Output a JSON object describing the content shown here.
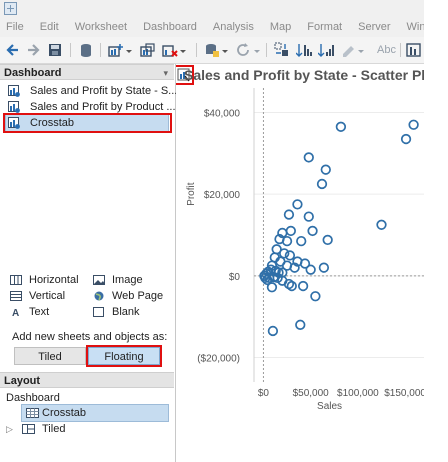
{
  "menu": [
    "File",
    "Edit",
    "Worksheet",
    "Dashboard",
    "Analysis",
    "Map",
    "Format",
    "Server",
    "Window"
  ],
  "toolbar": {
    "abc_label": "Abc"
  },
  "dashboard_pane": {
    "header": "Dashboard",
    "pin_icon": "▾",
    "sheets": [
      {
        "label": "Sales and Profit by State - S...",
        "icon": "sheet-used-icon"
      },
      {
        "label": "Sales and Profit by Product ...",
        "icon": "sheet-used-icon"
      },
      {
        "label": "Crosstab",
        "icon": "sheet-used-icon",
        "selected": true
      }
    ],
    "objects": [
      {
        "label": "Horizontal",
        "icon": "horizontal-container-icon"
      },
      {
        "label": "Image",
        "icon": "image-icon"
      },
      {
        "label": "Vertical",
        "icon": "vertical-container-icon"
      },
      {
        "label": "Web Page",
        "icon": "globe-icon"
      },
      {
        "label": "Text",
        "icon": "text-icon"
      },
      {
        "label": "Blank",
        "icon": "blank-icon"
      }
    ],
    "add_new_label": "Add new sheets and objects as:",
    "tiled_label": "Tiled",
    "floating_label": "Floating",
    "floating_selected": true
  },
  "layout_pane": {
    "header": "Layout",
    "root": "Dashboard",
    "items": [
      {
        "label": "Crosstab",
        "selected": true
      },
      {
        "label": "Tiled",
        "expandable": true
      }
    ]
  },
  "view": {
    "title": "Sales and Profit by State - Scatter Pl",
    "highlight_color": "#e01010",
    "point_color": "#2f6fa8"
  },
  "chart_data": {
    "type": "scatter",
    "title": "Sales and Profit by State - Scatter Pl",
    "xlabel": "Sales",
    "ylabel": "Profit",
    "xlim": [
      -10000,
      170000
    ],
    "ylim": [
      -26000,
      46000
    ],
    "x_ticks": [
      0,
      50000,
      100000,
      150000
    ],
    "x_tick_labels": [
      "$0",
      "$50,000",
      "$100,000",
      "$150,000"
    ],
    "y_ticks": [
      -20000,
      0,
      20000,
      40000
    ],
    "y_tick_labels": [
      "($20,000)",
      "$0",
      "$20,000",
      "$40,000"
    ],
    "zero_lines": true,
    "points": [
      [
        82000,
        36500
      ],
      [
        159000,
        37000
      ],
      [
        151000,
        33500
      ],
      [
        48000,
        29000
      ],
      [
        66000,
        26000
      ],
      [
        62000,
        22500
      ],
      [
        125000,
        12500
      ],
      [
        20000,
        10500
      ],
      [
        36000,
        17500
      ],
      [
        27000,
        15000
      ],
      [
        48000,
        14500
      ],
      [
        52000,
        11000
      ],
      [
        29000,
        11000
      ],
      [
        17000,
        9000
      ],
      [
        25000,
        8500
      ],
      [
        40000,
        8500
      ],
      [
        68000,
        8800
      ],
      [
        14000,
        6500
      ],
      [
        22000,
        5500
      ],
      [
        28000,
        5000
      ],
      [
        12000,
        4500
      ],
      [
        18000,
        3500
      ],
      [
        36000,
        3500
      ],
      [
        44000,
        3000
      ],
      [
        9000,
        2500
      ],
      [
        25000,
        2500
      ],
      [
        33000,
        2000
      ],
      [
        50000,
        1500
      ],
      [
        64000,
        2000
      ],
      [
        5000,
        1000
      ],
      [
        8000,
        1500
      ],
      [
        13000,
        1200
      ],
      [
        16000,
        800
      ],
      [
        20000,
        800
      ],
      [
        3000,
        500
      ],
      [
        1000,
        0
      ],
      [
        2000,
        -500
      ],
      [
        4000,
        -1000
      ],
      [
        6000,
        -500
      ],
      [
        11000,
        -300
      ],
      [
        15000,
        -500
      ],
      [
        20000,
        -1200
      ],
      [
        27000,
        -2000
      ],
      [
        30000,
        -2500
      ],
      [
        42000,
        -2500
      ],
      [
        9000,
        -2800
      ],
      [
        55000,
        -5000
      ],
      [
        39000,
        -12000
      ],
      [
        10000,
        -13500
      ]
    ]
  }
}
